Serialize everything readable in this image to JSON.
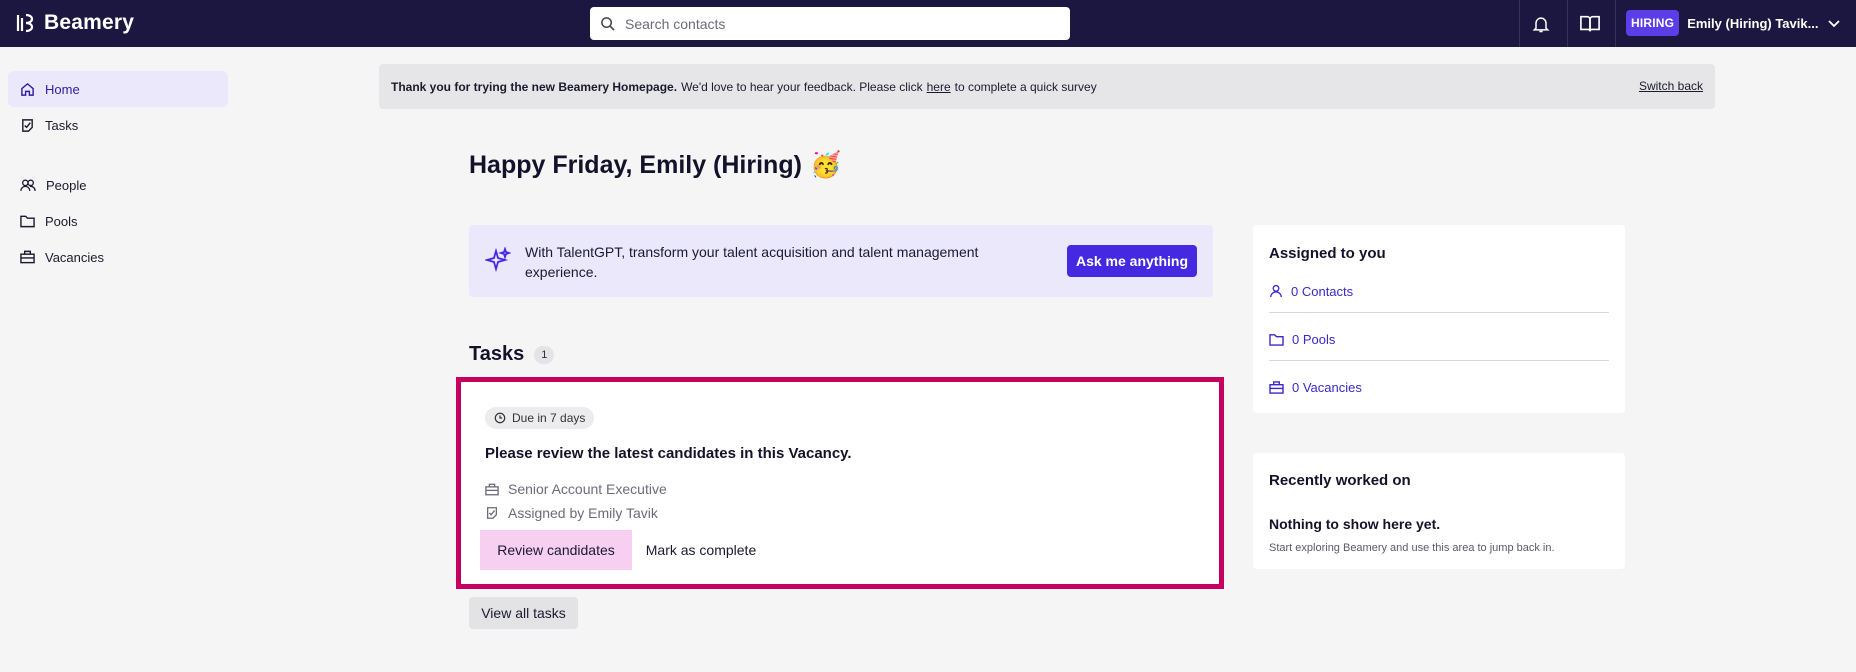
{
  "app": {
    "brand": "Beamery"
  },
  "search": {
    "placeholder": "Search contacts"
  },
  "profile": {
    "badge": "HIRING",
    "name": "Emily (Hiring) Tavik..."
  },
  "sidebar": {
    "items": [
      {
        "label": "Home",
        "icon": "home-icon",
        "active": true
      },
      {
        "label": "Tasks",
        "icon": "task-icon"
      },
      {
        "label": "People",
        "icon": "people-icon"
      },
      {
        "label": "Pools",
        "icon": "folder-icon"
      },
      {
        "label": "Vacancies",
        "icon": "briefcase-icon"
      }
    ]
  },
  "banner": {
    "bold": "Thank you for trying the new Beamery Homepage.",
    "text_before": "We'd love to hear your feedback. Please click",
    "link": "here",
    "text_after": "to complete a quick survey",
    "switch_back": "Switch back"
  },
  "greeting": {
    "text": "Happy Friday, Emily (Hiring)",
    "emoji": "🥳"
  },
  "talentgpt": {
    "text": "With TalentGPT, transform your talent acquisition and talent management experience.",
    "button": "Ask me anything"
  },
  "tasks": {
    "title": "Tasks",
    "count": "1",
    "card": {
      "due": "Due in 7 days",
      "title": "Please review the latest candidates in this Vacancy.",
      "vacancy": "Senior Account Executive",
      "assigned_by": "Assigned by Emily Tavik",
      "primary_action": "Review candidates",
      "secondary_action": "Mark as complete"
    },
    "view_all": "View all tasks"
  },
  "assigned": {
    "title": "Assigned to you",
    "items": [
      {
        "label": "0 Contacts",
        "icon": "person-icon"
      },
      {
        "label": "0 Pools",
        "icon": "folder-icon"
      },
      {
        "label": "0 Vacancies",
        "icon": "briefcase-icon"
      }
    ]
  },
  "recent": {
    "title": "Recently worked on",
    "empty_title": "Nothing to show here yet.",
    "empty_desc": "Start exploring Beamery and use this area to jump back in."
  },
  "colors": {
    "topbar": "#1c1741",
    "accent": "#4529e0",
    "highlight_border": "#c5005e",
    "review_button": "#f6cff1"
  }
}
